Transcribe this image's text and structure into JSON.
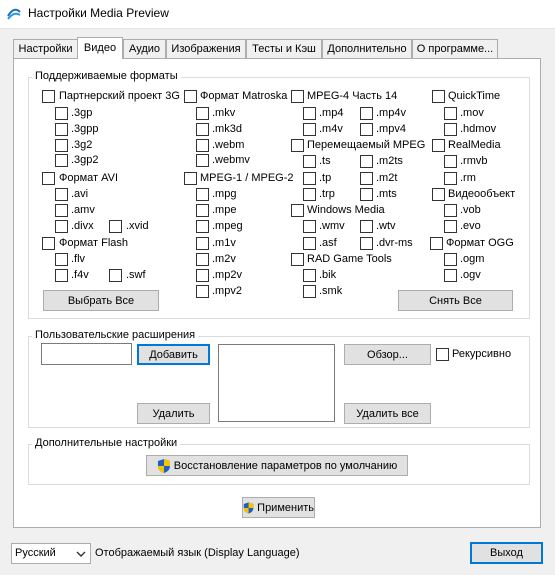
{
  "window": {
    "title": "Настройки Media Preview"
  },
  "tabs": [
    "Настройки",
    "Видео",
    "Аудио",
    "Изображения",
    "Тесты и Кэш",
    "Дополнительно",
    "О программе..."
  ],
  "formats_group": {
    "title": "Поддерживаемые форматы",
    "sections": [
      {
        "label": "Партнерский проект 3G",
        "items": [
          ".3gp",
          ".3gpp",
          ".3g2",
          ".3gp2"
        ]
      },
      {
        "label": "Формат AVI",
        "items": [
          ".avi",
          ".amv",
          ".divx",
          ".xvid"
        ]
      },
      {
        "label": "Формат Flash",
        "items": [
          ".flv",
          ".f4v",
          ".swf"
        ]
      },
      {
        "label": "Формат Matroska",
        "items": [
          ".mkv",
          ".mk3d",
          ".webm",
          ".webmv"
        ]
      },
      {
        "label": "MPEG-1 / MPEG-2",
        "items": [
          ".mpg",
          ".mpe",
          ".mpeg",
          ".m1v",
          ".m2v",
          ".mp2v",
          ".mpv2"
        ]
      },
      {
        "label": "MPEG-4 Часть 14",
        "items": [
          ".mp4",
          ".mp4v",
          ".m4v",
          ".mpv4"
        ]
      },
      {
        "label": "Перемещаемый MPEG",
        "items": [
          ".ts",
          ".m2ts",
          ".tp",
          ".m2t",
          ".trp",
          ".mts"
        ]
      },
      {
        "label": "Windows Media",
        "items": [
          ".wmv",
          ".wtv",
          ".asf",
          ".dvr-ms"
        ]
      },
      {
        "label": "RAD Game Tools",
        "items": [
          ".bik",
          ".smk"
        ]
      },
      {
        "label": "QuickTime",
        "items": [
          ".mov",
          ".hdmov"
        ]
      },
      {
        "label": "RealMedia",
        "items": [
          ".rmvb",
          ".rm"
        ]
      },
      {
        "label": "Видеообъект",
        "items": [
          ".vob",
          ".evo"
        ]
      },
      {
        "label": "Формат OGG",
        "items": [
          ".ogm",
          ".ogv"
        ]
      }
    ],
    "select_all": "Выбрать Все",
    "deselect_all": "Снять Все"
  },
  "custom_ext": {
    "title": "Пользовательские расширения",
    "input_value": "",
    "add": "Добавить",
    "remove": "Удалить",
    "browse": "Обзор...",
    "recursive": "Рекурсивно",
    "remove_all": "Удалить все"
  },
  "extra": {
    "title": "Дополнительные настройки",
    "restore": "Восстановление параметров по умолчанию"
  },
  "apply": "Применить",
  "footer": {
    "language_selected": "Русский",
    "language_label": "Отображаемый язык (Display Language)",
    "exit": "Выход"
  },
  "icons": {
    "app": "media-preview-app-icon",
    "shield": "uac-shield-icon",
    "dropdown": "chevron-down-icon"
  }
}
